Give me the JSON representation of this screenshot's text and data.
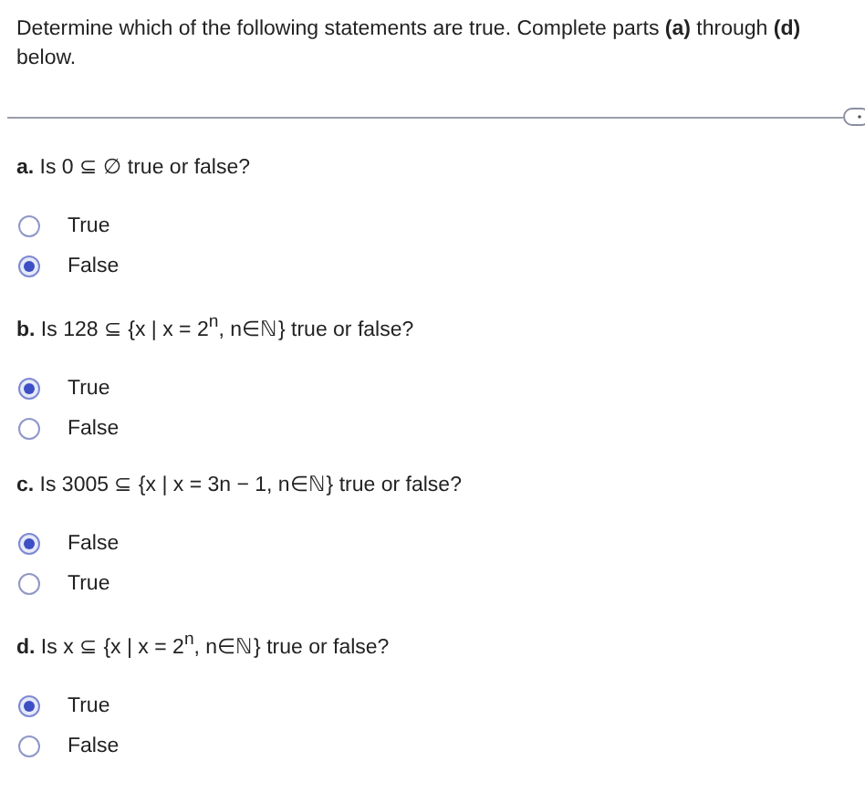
{
  "instructions": "Determine which of the following statements are true. Complete parts **(a)** through **(d)** below.",
  "parts": [
    {
      "question": "**a.** Is 0 ⊆ ∅ true or false?",
      "options": [
        {
          "label": "True",
          "selected": false
        },
        {
          "label": "False",
          "selected": true
        }
      ]
    },
    {
      "question": "**b.** Is 128 ⊆ {x | x = 2$^{n}$, n∈ℕ} true or false?",
      "options": [
        {
          "label": "True",
          "selected": true
        },
        {
          "label": "False",
          "selected": false
        }
      ]
    },
    {
      "question": "**c.** Is 3005 ⊆ {x | x = 3n − 1, n∈ℕ} true or false?",
      "options": [
        {
          "label": "False",
          "selected": true
        },
        {
          "label": "True",
          "selected": false
        }
      ]
    },
    {
      "question": "**d.** Is x ⊆ {x | x = 2$^{n}$, n∈ℕ} true or false?",
      "options": [
        {
          "label": "True",
          "selected": true
        },
        {
          "label": "False",
          "selected": false
        }
      ]
    }
  ]
}
